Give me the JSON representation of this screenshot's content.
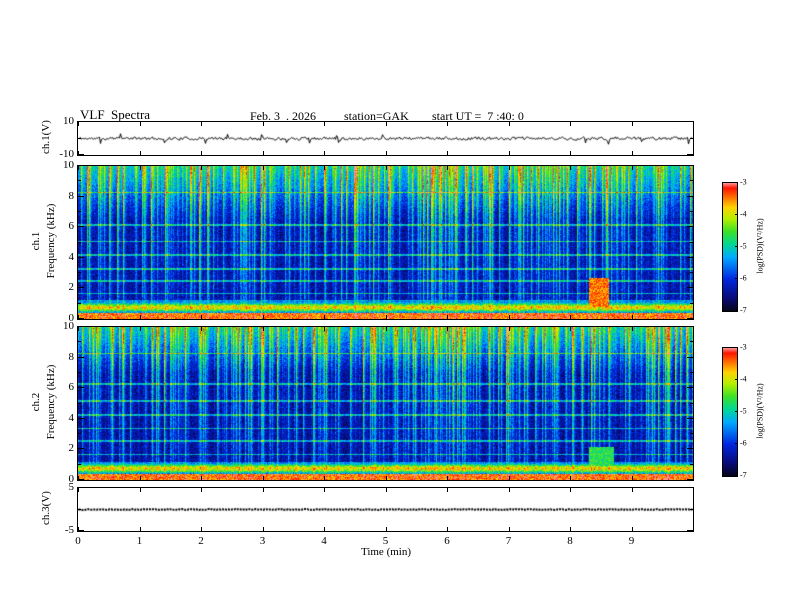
{
  "header": {
    "title": "VLF  Spectra",
    "date": "Feb. 3  . 2026",
    "station": "station=GAK",
    "start_ut": "start UT =  7 :40: 0"
  },
  "time_axis": {
    "label": "Time (min)",
    "range_min": [
      0,
      10
    ],
    "ticks": [
      {
        "v": 0,
        "label": "0"
      },
      {
        "v": 1,
        "label": "1"
      },
      {
        "v": 2,
        "label": "2"
      },
      {
        "v": 3,
        "label": "3"
      },
      {
        "v": 4,
        "label": "4"
      },
      {
        "v": 5,
        "label": "5"
      },
      {
        "v": 6,
        "label": "6"
      },
      {
        "v": 7,
        "label": "7"
      },
      {
        "v": 8,
        "label": "8"
      },
      {
        "v": 9,
        "label": "9"
      },
      {
        "v": 10
      }
    ]
  },
  "colormap": {
    "stops": [
      [
        0,
        [
          5,
          5,
          25
        ]
      ],
      [
        0.1,
        [
          8,
          10,
          120
        ]
      ],
      [
        0.25,
        [
          0,
          40,
          224
        ]
      ],
      [
        0.42,
        [
          0,
          170,
          255
        ]
      ],
      [
        0.52,
        [
          0,
          215,
          150
        ]
      ],
      [
        0.62,
        [
          60,
          225,
          40
        ]
      ],
      [
        0.72,
        [
          180,
          240,
          0
        ]
      ],
      [
        0.81,
        [
          255,
          210,
          0
        ]
      ],
      [
        0.89,
        [
          255,
          110,
          0
        ]
      ],
      [
        0.96,
        [
          255,
          20,
          0
        ]
      ],
      [
        1,
        [
          255,
          150,
          150
        ]
      ]
    ]
  },
  "colorbar": {
    "label": "log(PSD)(V²/Hz)",
    "ticks": [
      "-3",
      "-4",
      "-5",
      "-6",
      "-7"
    ],
    "range_log_psd": [
      -7,
      -3
    ]
  },
  "chart_data": [
    {
      "type": "line",
      "name": "ch1-voltage-waveform",
      "ylabel": "ch.1(V)",
      "ylim": [
        -10,
        10
      ],
      "yticks": [
        {
          "v": 10,
          "label": "10"
        },
        {
          "v": 0
        },
        {
          "v": -10,
          "label": "-10"
        }
      ],
      "x_range_min": [
        0,
        10
      ],
      "signal": {
        "seed": 11,
        "mean_v": 0,
        "noise_amp_v": 1.3,
        "spike_prob": 0.03,
        "spike_amp_v": 6
      }
    },
    {
      "type": "heatmap",
      "name": "ch1-spectrogram",
      "ylabel_lines": [
        "ch.1",
        "Frequency (kHz)"
      ],
      "ylim_khz": [
        0,
        10
      ],
      "yticks": [
        {
          "v": 0,
          "label": "0"
        },
        {
          "v": 1
        },
        {
          "v": 2,
          "label": "2"
        },
        {
          "v": 3
        },
        {
          "v": 4,
          "label": "4"
        },
        {
          "v": 5
        },
        {
          "v": 6,
          "label": "6"
        },
        {
          "v": 7
        },
        {
          "v": 8,
          "label": "8"
        },
        {
          "v": 9
        },
        {
          "v": 10,
          "label": "10"
        }
      ],
      "x_range_min": [
        0,
        10
      ],
      "z_range_log_psd": [
        -7,
        -3
      ],
      "content": {
        "seed": 21,
        "background_level": 0.13,
        "strong_band_below_khz": 1.3,
        "speckle_above_khz": 6.5,
        "sferic_streak_prob": 0.12,
        "interference_lines_khz": [
          1.7,
          2.5,
          3.3,
          4.2,
          5.1,
          6.2,
          8.3
        ],
        "event": {
          "t_min": [
            8.3,
            8.62
          ],
          "f_khz": [
            0.8,
            2.7
          ],
          "level": 0.88
        }
      }
    },
    {
      "type": "heatmap",
      "name": "ch2-spectrogram",
      "ylabel_lines": [
        "ch.2",
        "Frequency (kHz)"
      ],
      "ylim_khz": [
        0,
        10
      ],
      "yticks": [
        {
          "v": 0,
          "label": "0"
        },
        {
          "v": 1
        },
        {
          "v": 2,
          "label": "2"
        },
        {
          "v": 3
        },
        {
          "v": 4,
          "label": "4"
        },
        {
          "v": 5
        },
        {
          "v": 6,
          "label": "6"
        },
        {
          "v": 7
        },
        {
          "v": 8,
          "label": "8"
        },
        {
          "v": 9
        },
        {
          "v": 10,
          "label": "10"
        }
      ],
      "x_range_min": [
        0,
        10
      ],
      "z_range_log_psd": [
        -7,
        -3
      ],
      "content": {
        "seed": 22,
        "background_level": 0.12,
        "strong_band_below_khz": 1.2,
        "speckle_above_khz": 7.0,
        "sferic_streak_prob": 0.1,
        "interference_lines_khz": [
          1.7,
          2.6,
          3.4,
          4.3,
          5.2,
          6.3,
          8.3
        ],
        "event": {
          "t_min": [
            8.3,
            8.7
          ],
          "f_khz": [
            0.8,
            2.2
          ],
          "level": 0.58
        }
      }
    },
    {
      "type": "line",
      "name": "ch3-voltage-waveform",
      "ylabel": "ch.3(V)",
      "ylim": [
        -5,
        5
      ],
      "yticks": [
        {
          "v": 5,
          "label": "5"
        },
        {
          "v": 0
        },
        {
          "v": -5,
          "label": "-5"
        }
      ],
      "x_range_min": [
        0,
        10
      ],
      "signal": {
        "seed": 13,
        "mean_v": 0,
        "noise_amp_v": 0.12,
        "spike_prob": 0,
        "spike_amp_v": 0
      }
    }
  ]
}
